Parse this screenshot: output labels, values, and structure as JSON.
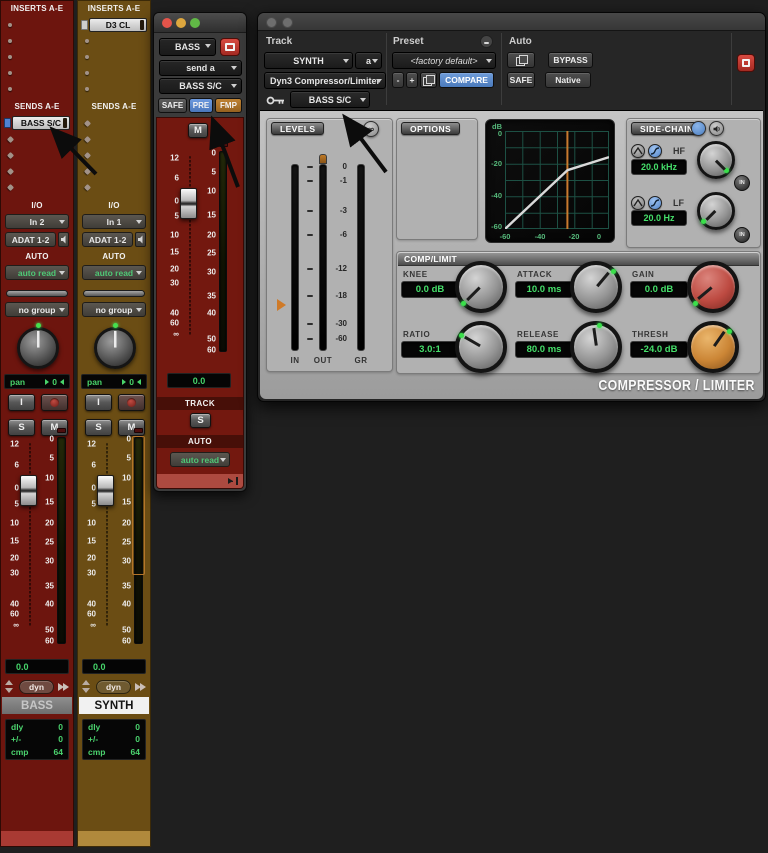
{
  "strips": [
    {
      "inserts_header": "INSERTS A-E",
      "sends_header": "SENDS A-E",
      "send_a": "BASS S/C",
      "io_label": "I/O",
      "input": "In 2",
      "output": "ADAT 1-2",
      "auto_label": "AUTO",
      "auto_mode": "auto read",
      "group": "no group",
      "pan_label": "pan",
      "pan_value": "0",
      "input_monitor": "I",
      "solo": "S",
      "mute": "M",
      "volume": "0.0",
      "dyn": "dyn",
      "name": "BASS",
      "info_rows": [
        {
          "label": "dly",
          "value": "0"
        },
        {
          "label": "+/-",
          "value": "0"
        },
        {
          "label": "cmp",
          "value": "64"
        }
      ]
    },
    {
      "inserts_header": "INSERTS A-E",
      "insert_a": "D3 CL",
      "sends_header": "SENDS A-E",
      "io_label": "I/O",
      "input": "In 1",
      "output": "ADAT 1-2",
      "auto_label": "AUTO",
      "auto_mode": "auto read",
      "group": "no group",
      "pan_label": "pan",
      "pan_value": "0",
      "input_monitor": "I",
      "solo": "S",
      "mute": "M",
      "volume": "0.0",
      "dyn": "dyn",
      "name": "SYNTH",
      "info_rows": [
        {
          "label": "dly",
          "value": "0"
        },
        {
          "label": "+/-",
          "value": "0"
        },
        {
          "label": "cmp",
          "value": "64"
        }
      ]
    }
  ],
  "fader_scale": [
    "12",
    "6",
    "0",
    "5",
    "10",
    "15",
    "20",
    "30",
    "40",
    "60",
    "∞"
  ],
  "meter_scale": [
    "0",
    "5",
    "10",
    "15",
    "20",
    "25",
    "30",
    "35",
    "40",
    "50",
    "60"
  ],
  "send_window": {
    "track": "BASS",
    "send_slot": "send a",
    "destination": "BASS S/C",
    "safe": "SAFE",
    "pre": "PRE",
    "fmp": "FMP",
    "mute": "M",
    "volume": "0.0",
    "track_section": "TRACK",
    "solo": "S",
    "auto_section": "AUTO",
    "auto_mode": "auto read"
  },
  "plugin": {
    "track_label": "Track",
    "preset_label": "Preset",
    "auto_label": "Auto",
    "track_name": "SYNTH",
    "insert_position": "a",
    "plugin_name": "Dyn3 Compressor/Limiter",
    "preset_name": "<factory default>",
    "minus": "-",
    "plus": "+",
    "compare": "COMPARE",
    "bypass": "BYPASS",
    "safe": "SAFE",
    "native": "Native",
    "key_input": "BASS S/C",
    "levels": {
      "title": "LEVELS",
      "scale": [
        "0",
        "-1",
        "-3",
        "-6",
        "-12",
        "-18",
        "-30",
        "-60"
      ],
      "meters": [
        "IN",
        "OUT",
        "GR"
      ]
    },
    "options_title": "OPTIONS",
    "graph": {
      "ylabel": "dB",
      "yticks": [
        "0",
        "-20",
        "-40",
        "-60"
      ],
      "xticks": [
        "-60",
        "-40",
        "-20",
        "0"
      ],
      "threshold_db": -24,
      "curve": [
        [
          -60,
          -60
        ],
        [
          -24,
          -24
        ],
        [
          0,
          -16
        ]
      ]
    },
    "side_chain": {
      "title": "SIDE-CHAIN",
      "hf_label": "HF",
      "hf_value": "20.0 kHz",
      "lf_label": "LF",
      "lf_value": "20.0 Hz",
      "in_label": "IN"
    },
    "comp_limit": {
      "title": "COMP/LIMIT",
      "knobs": [
        {
          "label": "KNEE",
          "value": "0.0 dB"
        },
        {
          "label": "ATTACK",
          "value": "10.0 ms"
        },
        {
          "label": "GAIN",
          "value": "0.0 dB"
        },
        {
          "label": "RATIO",
          "value": "3.0:1"
        },
        {
          "label": "RELEASE",
          "value": "80.0 ms"
        },
        {
          "label": "THRESH",
          "value": "-24.0 dB"
        }
      ]
    },
    "footer_title": "COMPRESSOR / LIMITER",
    "accent_colors": {
      "display_green": "#45e06a",
      "threshold_orange": "#c97a2e"
    }
  }
}
